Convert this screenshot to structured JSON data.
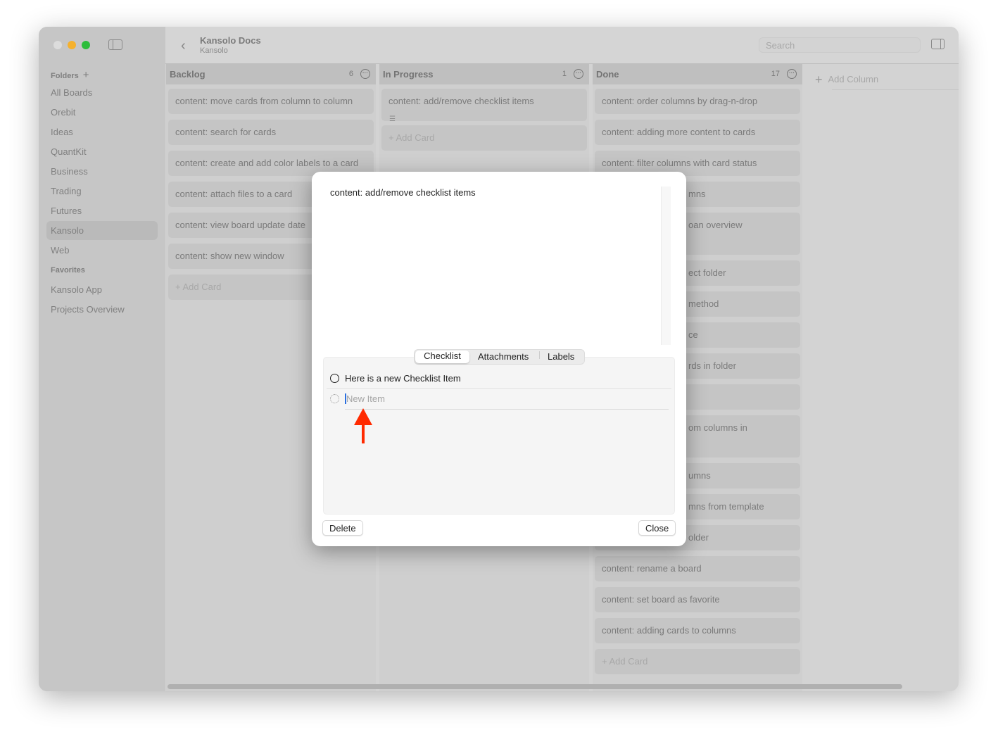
{
  "window": {
    "title": "Kansolo Docs",
    "subtitle": "Kansolo",
    "search_placeholder": "Search"
  },
  "sidebar": {
    "folders_label": "Folders",
    "items": [
      "All Boards",
      "Orebit",
      "Ideas",
      "QuantKit",
      "Business",
      "Trading",
      "Futures",
      "Kansolo",
      "Web"
    ],
    "selected": "Kansolo",
    "favorites_label": "Favorites",
    "favorites": [
      "Kansolo App",
      "Projects Overview"
    ]
  },
  "columns": [
    {
      "title": "Backlog",
      "count": "6",
      "cards": [
        "content: move cards from column to column",
        "content: search for cards",
        "content: create and add color labels to a card",
        "content: attach files to a card",
        "content: view board update date",
        "content: show new window"
      ],
      "add": "+ Add Card"
    },
    {
      "title": "In Progress",
      "count": "1",
      "cards": [
        "content: add/remove checklist items"
      ],
      "add": "+ Add Card"
    },
    {
      "title": "Done",
      "count": "17",
      "cards": [
        "content: order columns by drag-n-drop",
        "content: adding more content to cards",
        "content: filter columns with card status",
        "mns",
        "oan overview",
        "ect folder",
        "method",
        "ce",
        "rds in folder",
        "",
        "om columns in",
        "umns",
        "mns from template",
        "older",
        "content: rename a board",
        "content: set board as favorite",
        "content: adding cards to columns"
      ],
      "add": "+ Add Card"
    }
  ],
  "add_column": "Add Column",
  "modal": {
    "title": "content: add/remove checklist items",
    "tabs": [
      "Checklist",
      "Attachments",
      "Labels"
    ],
    "active_tab": "Checklist",
    "checklist": [
      "Here is a new Checklist Item"
    ],
    "new_item_placeholder": "New Item",
    "delete": "Delete",
    "close": "Close"
  },
  "colors": {
    "accent": "#2a6fe0",
    "arrow": "#ff2a00",
    "close": "#dcdcdc",
    "minimize": "#f5b12e",
    "zoom": "#2dbd3b"
  }
}
